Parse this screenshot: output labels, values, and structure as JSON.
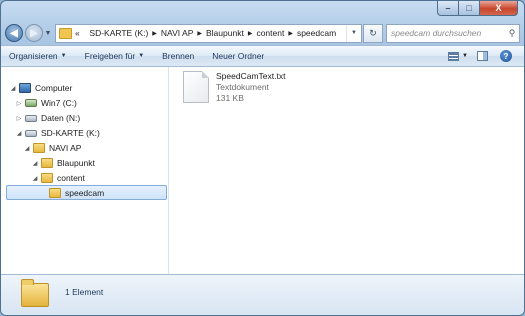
{
  "window": {
    "caption_buttons": {
      "minimize": "–",
      "maximize": "□",
      "close": "X"
    }
  },
  "address_bar": {
    "back_glyph": "◀",
    "forward_glyph": "▶",
    "overflow": "«",
    "breadcrumbs": [
      "SD-KARTE (K:)",
      "NAVI AP",
      "Blaupunkt",
      "content",
      "speedcam"
    ],
    "refresh_glyph": "↻"
  },
  "search": {
    "placeholder": "speedcam durchsuchen"
  },
  "toolbar": {
    "organize": "Organisieren",
    "share": "Freigeben für",
    "burn": "Brennen",
    "new_folder": "Neuer Ordner",
    "help_glyph": "?"
  },
  "tree": {
    "items": [
      {
        "label": "Computer",
        "icon": "computer-icon",
        "expanded": true
      },
      {
        "label": "Win7 (C:)",
        "icon": "drive-icon",
        "expanded": false
      },
      {
        "label": "Daten (N:)",
        "icon": "drive-icon",
        "expanded": false
      },
      {
        "label": "SD-KARTE (K:)",
        "icon": "drive-icon",
        "expanded": true
      },
      {
        "label": "NAVI AP",
        "icon": "folder-icon",
        "expanded": true
      },
      {
        "label": "Blaupunkt",
        "icon": "folder-icon",
        "expanded": true
      },
      {
        "label": "content",
        "icon": "folder-icon",
        "expanded": true
      },
      {
        "label": "speedcam",
        "icon": "folder-icon",
        "selected": true
      }
    ]
  },
  "files": [
    {
      "name": "SpeedCamText.txt",
      "type": "Textdokument",
      "size": "131 KB",
      "icon": "text-document-icon"
    }
  ],
  "details_pane": {
    "count": "1 Element",
    "icon": "folder-icon"
  }
}
